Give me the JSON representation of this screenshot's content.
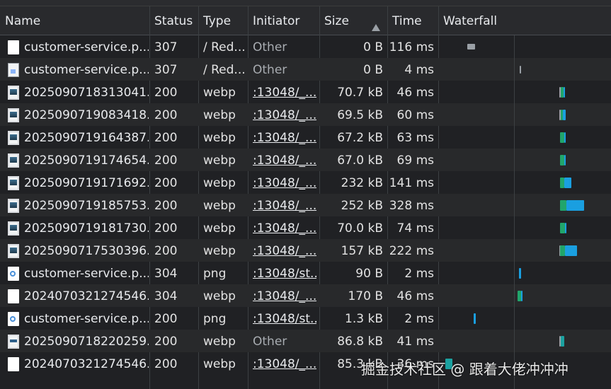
{
  "columns": {
    "name": "Name",
    "status": "Status",
    "type": "Type",
    "initiator": "Initiator",
    "size": "Size",
    "time": "Time",
    "waterfall": "Waterfall"
  },
  "colors": {
    "waiting": "#21a56b",
    "download": "#1a9fe0",
    "queue": "#9aa0a6",
    "link_teal": "#1ba1a0"
  },
  "rows": [
    {
      "icon": "document-icon",
      "name": "customer-service.p...",
      "status": "307",
      "type": "/ Red...",
      "initiator": "Other",
      "initiator_link": false,
      "size": "0 B",
      "time": "116 ms",
      "bars": [
        {
          "kind": "queue",
          "start": 0.163,
          "end": 0.205,
          "height": "tall"
        }
      ]
    },
    {
      "icon": "broken-image-icon",
      "name": "customer-service.p...",
      "status": "307",
      "type": "/ Red...",
      "initiator": "Other",
      "initiator_link": false,
      "size": "0 B",
      "time": "4 ms",
      "bars": [
        {
          "kind": "queue",
          "start": 0.467,
          "end": 0.475,
          "height": "thin"
        }
      ]
    },
    {
      "icon": "image-file-icon",
      "name": "2025090718313041...",
      "status": "200",
      "type": "webp",
      "initiator": ":13048/_...",
      "initiator_link": true,
      "size": "70.7 kB",
      "time": "46 ms",
      "bars": [
        {
          "kind": "queue",
          "start": 0.698,
          "end": 0.706
        },
        {
          "kind": "waiting",
          "start": 0.706,
          "end": 0.723
        },
        {
          "kind": "download",
          "start": 0.723,
          "end": 0.728
        }
      ]
    },
    {
      "icon": "image-file-icon",
      "name": "2025090719083418...",
      "status": "200",
      "type": "webp",
      "initiator": ":13048/_...",
      "initiator_link": true,
      "size": "69.5 kB",
      "time": "60 ms",
      "bars": [
        {
          "kind": "queue",
          "start": 0.698,
          "end": 0.706
        },
        {
          "kind": "waiting",
          "start": 0.706,
          "end": 0.719
        },
        {
          "kind": "download",
          "start": 0.719,
          "end": 0.736
        }
      ]
    },
    {
      "icon": "image-file-icon",
      "name": "2025090719164387...",
      "status": "200",
      "type": "webp",
      "initiator": ":13048/_...",
      "initiator_link": true,
      "size": "67.2 kB",
      "time": "63 ms",
      "bars": [
        {
          "kind": "waiting",
          "start": 0.702,
          "end": 0.727
        },
        {
          "kind": "download",
          "start": 0.727,
          "end": 0.731
        }
      ]
    },
    {
      "icon": "image-file-icon",
      "name": "2025090719174654...",
      "status": "200",
      "type": "webp",
      "initiator": ":13048/_...",
      "initiator_link": true,
      "size": "67.0 kB",
      "time": "69 ms",
      "bars": [
        {
          "kind": "waiting",
          "start": 0.702,
          "end": 0.727
        },
        {
          "kind": "download",
          "start": 0.727,
          "end": 0.731
        }
      ]
    },
    {
      "icon": "image-file-icon",
      "name": "2025090719171692...",
      "status": "200",
      "type": "webp",
      "initiator": ":13048/_...",
      "initiator_link": true,
      "size": "232 kB",
      "time": "141 ms",
      "bars": [
        {
          "kind": "waiting",
          "start": 0.702,
          "end": 0.727
        },
        {
          "kind": "download",
          "start": 0.727,
          "end": 0.769
        }
      ]
    },
    {
      "icon": "image-file-icon",
      "name": "2025090719185753...",
      "status": "200",
      "type": "webp",
      "initiator": ":13048/_...",
      "initiator_link": true,
      "size": "252 kB",
      "time": "328 ms",
      "bars": [
        {
          "kind": "waiting",
          "start": 0.702,
          "end": 0.74
        },
        {
          "kind": "download",
          "start": 0.74,
          "end": 0.843
        }
      ]
    },
    {
      "icon": "image-file-icon",
      "name": "2025090719181730...",
      "status": "200",
      "type": "webp",
      "initiator": ":13048/_...",
      "initiator_link": true,
      "size": "70.0 kB",
      "time": "74 ms",
      "bars": [
        {
          "kind": "waiting",
          "start": 0.702,
          "end": 0.731
        },
        {
          "kind": "download",
          "start": 0.731,
          "end": 0.736
        }
      ]
    },
    {
      "icon": "image-file-icon",
      "name": "2025090717530396...",
      "status": "200",
      "type": "webp",
      "initiator": ":13048/_...",
      "initiator_link": true,
      "size": "157 kB",
      "time": "222 ms",
      "bars": [
        {
          "kind": "queue",
          "start": 0.698,
          "end": 0.702
        },
        {
          "kind": "waiting",
          "start": 0.702,
          "end": 0.731
        },
        {
          "kind": "download",
          "start": 0.731,
          "end": 0.802
        }
      ]
    },
    {
      "icon": "png-icon",
      "name": "customer-service.p...",
      "status": "304",
      "type": "png",
      "initiator": ":13048/st...",
      "initiator_link": true,
      "size": "90 B",
      "time": "2 ms",
      "bars": [
        {
          "kind": "download",
          "start": 0.463,
          "end": 0.475
        }
      ]
    },
    {
      "icon": "document-icon",
      "name": "2024070321274546...",
      "status": "304",
      "type": "webp",
      "initiator": ":13048/_...",
      "initiator_link": true,
      "size": "170 B",
      "time": "46 ms",
      "bars": [
        {
          "kind": "waiting",
          "start": 0.455,
          "end": 0.475
        },
        {
          "kind": "download",
          "start": 0.475,
          "end": 0.479
        }
      ]
    },
    {
      "icon": "png-icon",
      "name": "customer-service.p...",
      "status": "200",
      "type": "png",
      "initiator": ":13048/st...",
      "initiator_link": true,
      "size": "1.3 kB",
      "time": "2 ms",
      "bars": [
        {
          "kind": "download",
          "start": 0.198,
          "end": 0.211
        }
      ]
    },
    {
      "icon": "banner-image-icon",
      "name": "2025090718220259...",
      "status": "200",
      "type": "webp",
      "initiator": "Other",
      "initiator_link": false,
      "size": "86.8 kB",
      "time": "41 ms",
      "bars": [
        {
          "kind": "queue",
          "start": 0.698,
          "end": 0.706
        },
        {
          "kind": "link_teal",
          "start": 0.706,
          "end": 0.727
        }
      ]
    },
    {
      "icon": "document-icon",
      "name": "2024070321274546...",
      "status": "200",
      "type": "webp",
      "initiator": ":13048/_...",
      "initiator_link": true,
      "size": "85.3 kB",
      "time": "36 ms",
      "bars": [
        {
          "kind": "link_teal",
          "start": 0.033,
          "end": 0.074
        }
      ]
    }
  ],
  "waterfall_gridlines": [
    0.434
  ],
  "watermark": "掘金技术社区 @ 跟着大佬冲冲冲"
}
